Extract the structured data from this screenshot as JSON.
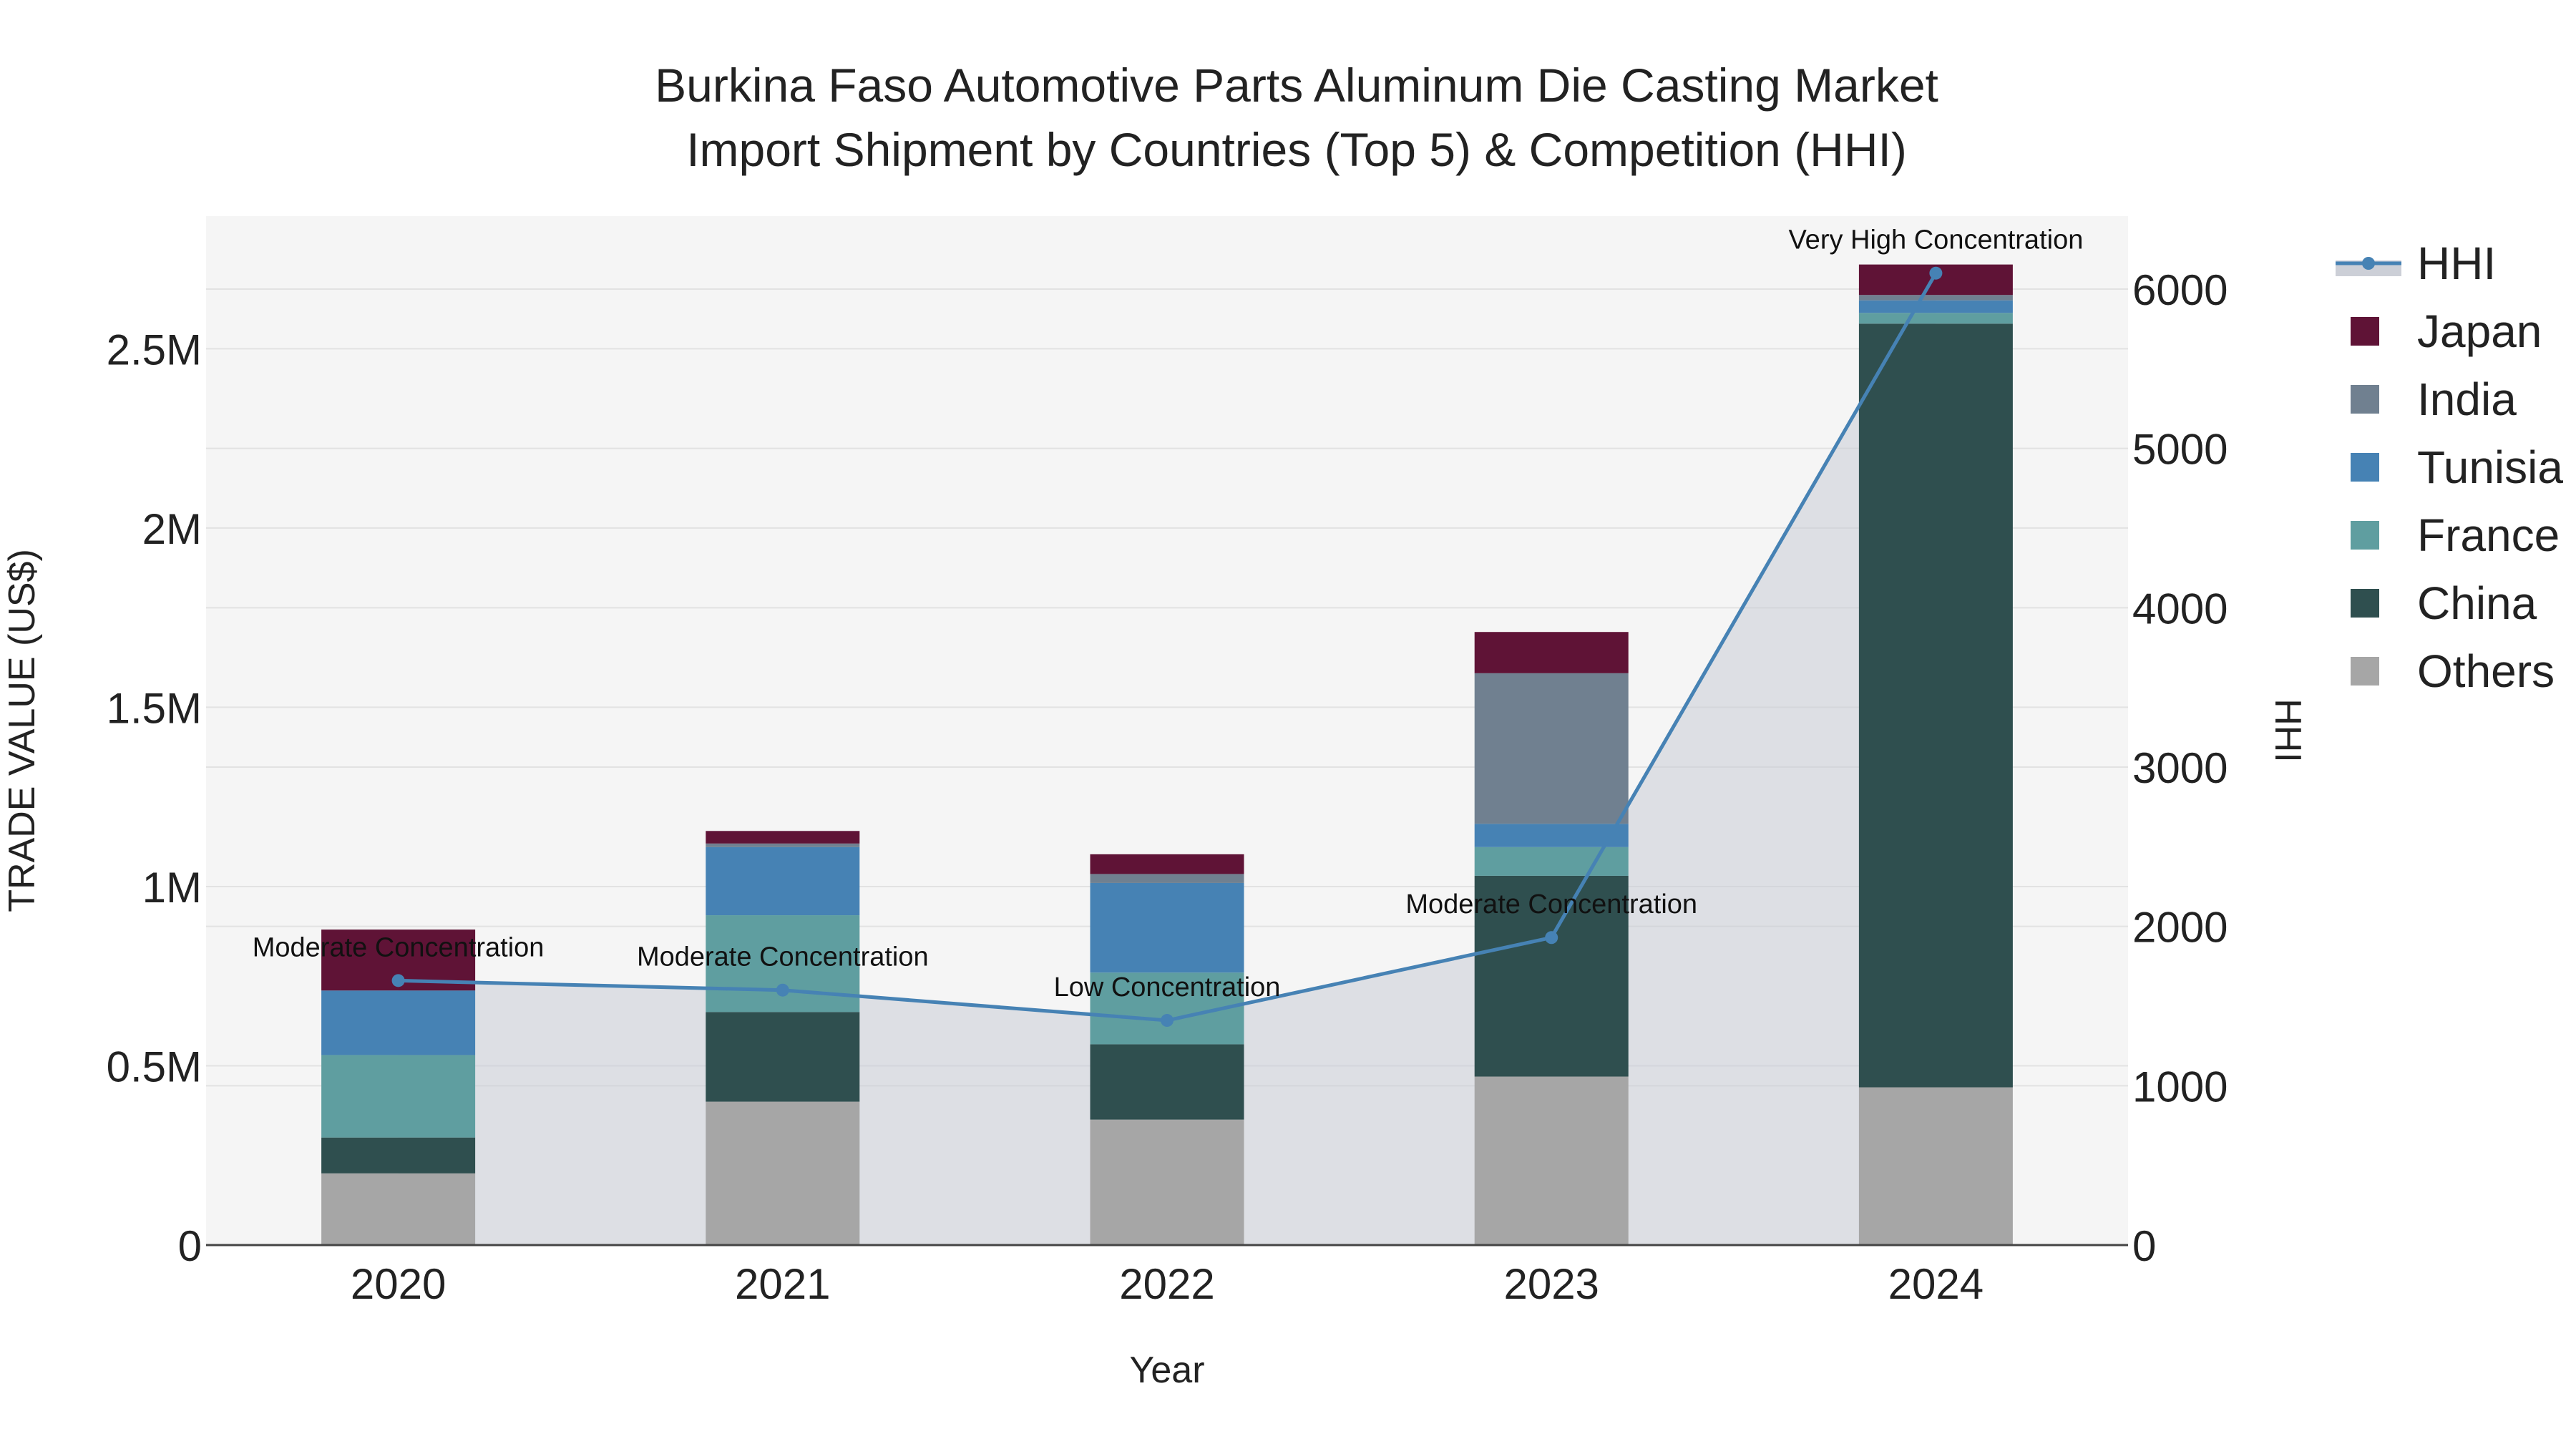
{
  "chart_data": {
    "type": "bar",
    "title_lines": [
      "Burkina Faso Automotive Parts Aluminum Die Casting Market",
      "Import Shipment by Countries (Top 5) & Competition (HHI)"
    ],
    "xlabel": "Year",
    "ylabel": "TRADE VALUE (US$)",
    "y2label": "HHI",
    "categories": [
      "2020",
      "2021",
      "2022",
      "2023",
      "2024"
    ],
    "ylim": [
      0,
      2870000
    ],
    "y2lim": [
      0,
      6458
    ],
    "yticks": [
      {
        "value": 0,
        "label": "0"
      },
      {
        "value": 500000,
        "label": "0.5M"
      },
      {
        "value": 1000000,
        "label": "1M"
      },
      {
        "value": 1500000,
        "label": "1.5M"
      },
      {
        "value": 2000000,
        "label": "2M"
      },
      {
        "value": 2500000,
        "label": "2.5M"
      }
    ],
    "y2ticks": [
      {
        "value": 0,
        "label": "0"
      },
      {
        "value": 1000,
        "label": "1000"
      },
      {
        "value": 2000,
        "label": "2000"
      },
      {
        "value": 3000,
        "label": "3000"
      },
      {
        "value": 4000,
        "label": "4000"
      },
      {
        "value": 5000,
        "label": "5000"
      },
      {
        "value": 6000,
        "label": "6000"
      }
    ],
    "series": [
      {
        "name": "Others",
        "color": "#a6a6a6",
        "values": [
          200000,
          400000,
          350000,
          470000,
          440000
        ]
      },
      {
        "name": "China",
        "color": "#2f4f4f",
        "values": [
          100000,
          250000,
          210000,
          560000,
          2130000
        ]
      },
      {
        "name": "France",
        "color": "#5f9ea0",
        "values": [
          230000,
          270000,
          200000,
          80000,
          30000
        ]
      },
      {
        "name": "Tunisia",
        "color": "#4682b4",
        "values": [
          180000,
          190000,
          250000,
          65000,
          35000
        ]
      },
      {
        "name": "India",
        "color": "#708090",
        "values": [
          0,
          10000,
          25000,
          420000,
          15000
        ]
      },
      {
        "name": "Japan",
        "color": "#5f1336",
        "values": [
          170000,
          35000,
          55000,
          115000,
          85000
        ]
      }
    ],
    "hhi": {
      "name": "HHI",
      "color": "#4682b4",
      "area_color": "#c6cad3",
      "values": [
        1660,
        1600,
        1410,
        1930,
        6100
      ],
      "annotations": [
        "Moderate Concentration",
        "Moderate Concentration",
        "Low Concentration",
        "Moderate Concentration",
        "Very High Concentration"
      ]
    },
    "legend_order": [
      "HHI",
      "Japan",
      "India",
      "Tunisia",
      "France",
      "China",
      "Others"
    ],
    "legend_position": "right",
    "grid": true
  }
}
